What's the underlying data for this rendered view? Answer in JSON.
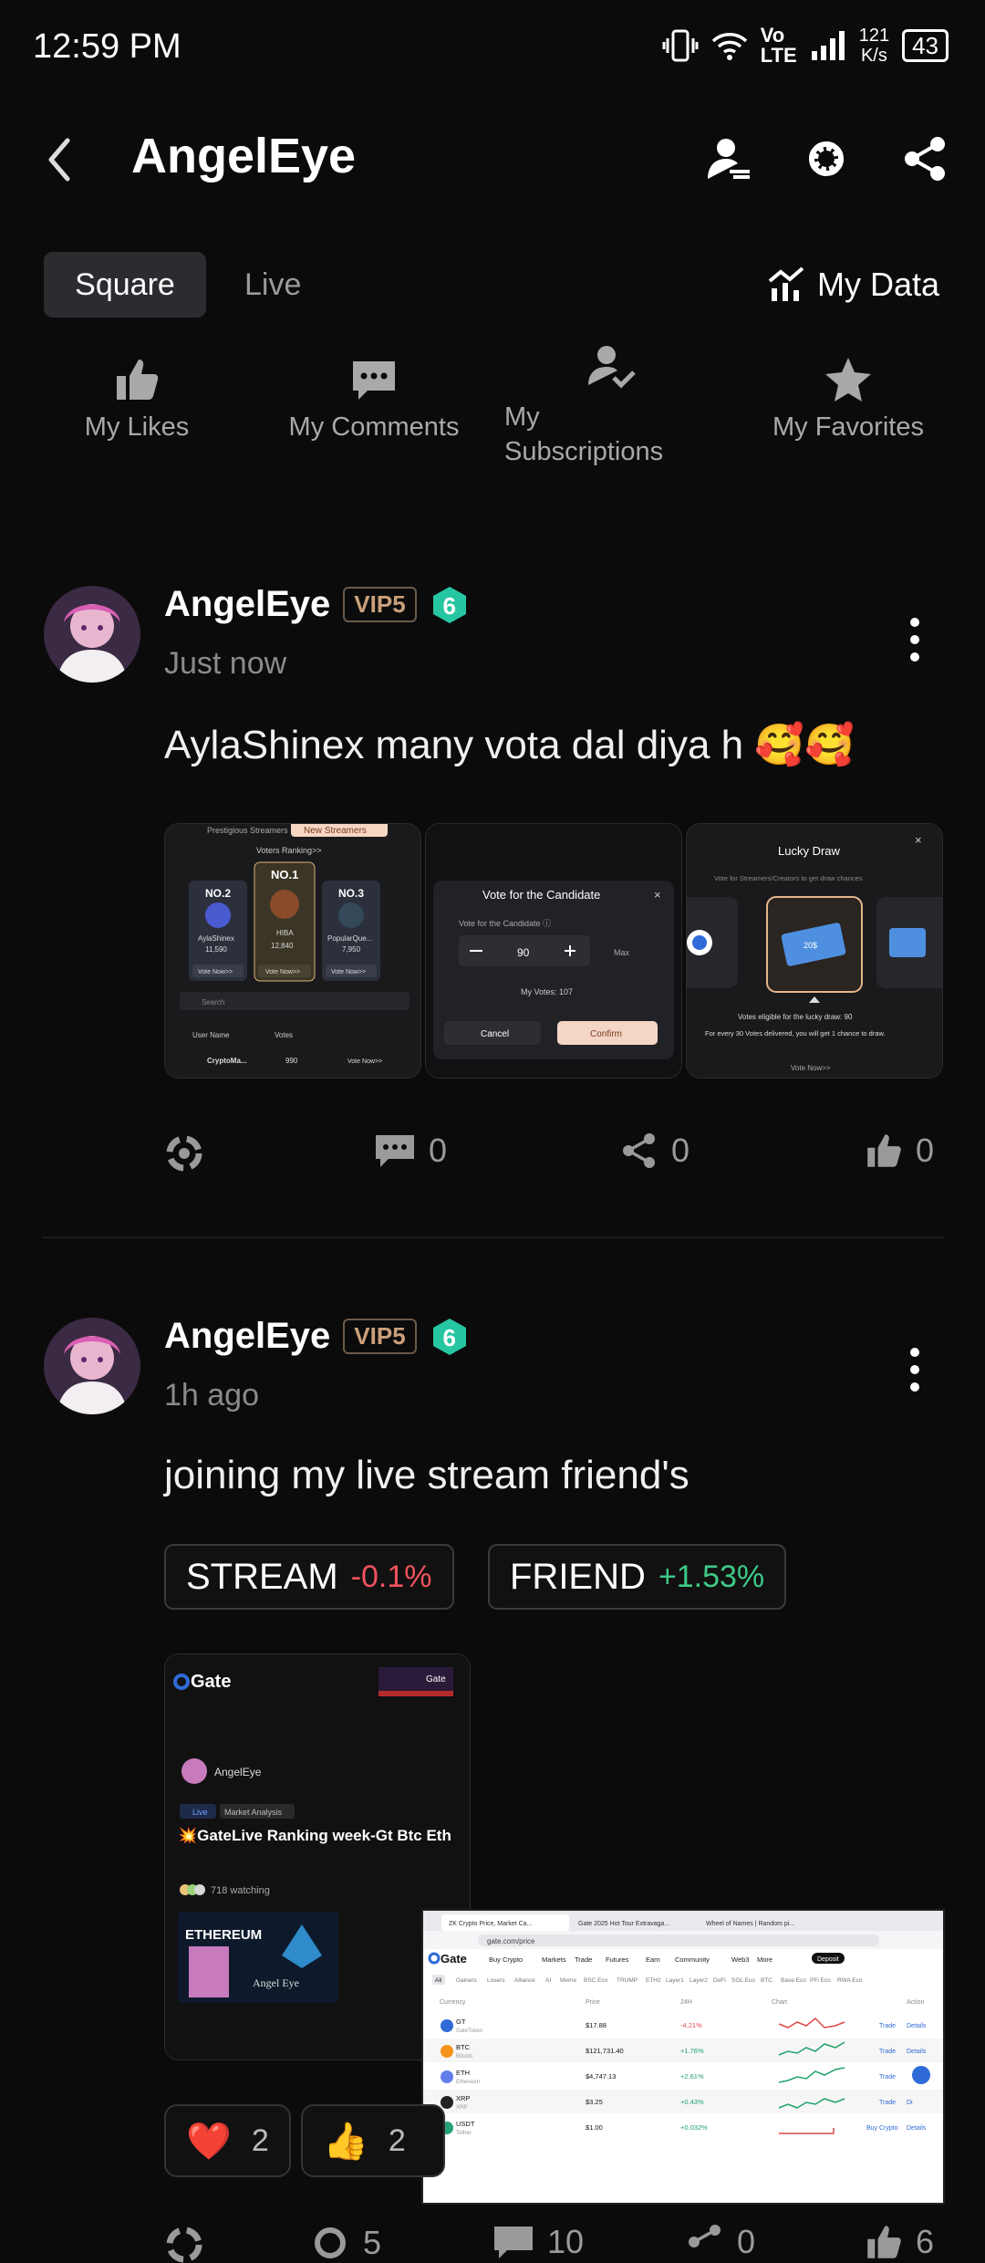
{
  "status_bar": {
    "time": "12:59 PM",
    "net_rate_top": "121",
    "net_rate_bottom": "K/s",
    "battery": "43",
    "volte": "Vo LTE"
  },
  "header": {
    "title": "AngelEye",
    "icons": [
      "back-arrow-icon",
      "person-icon",
      "gear-icon",
      "share-icon"
    ]
  },
  "tabs": {
    "square": "Square",
    "live": "Live",
    "my_data": "My Data"
  },
  "quick_actions": [
    {
      "label": "My Likes",
      "icon": "thumb-up-icon"
    },
    {
      "label": "My Comments",
      "icon": "comment-icon"
    },
    {
      "label": "My Subscriptions",
      "icon": "subscription-icon"
    },
    {
      "label": "My Favorites",
      "icon": "star-icon"
    }
  ],
  "posts": [
    {
      "username": "AngelEye",
      "vip": "VIP5",
      "level": "6",
      "time": "Just now",
      "content": "AylaShinex many vota dal diya h 🥰🥰",
      "images": {
        "img1": {
          "tabs": [
            "Prestigious Streamers",
            "New Streamers"
          ],
          "header": "Voters Ranking>>",
          "ranks": [
            {
              "rank": "NO.2",
              "name": "AylaShinex",
              "votes": "11,590",
              "btn": "Vote Now>>"
            },
            {
              "rank": "NO.1",
              "name": "HIBA",
              "votes": "12,840",
              "btn": "Vote Now>>"
            },
            {
              "rank": "NO.3",
              "name": "PopularQue...",
              "votes": "7,950",
              "btn": "Vote Now>>"
            }
          ],
          "search": "Search",
          "col_user": "User Name",
          "col_votes": "Votes",
          "row_name": "CryptoMa...",
          "row_votes": "990",
          "row_btn": "Vote Now>>"
        },
        "img2": {
          "title": "Vote for the Candidate",
          "label": "Vote for the Candidate ⓘ",
          "value": "90",
          "max": "Max",
          "my_votes": "My Votes: 107",
          "cancel": "Cancel",
          "confirm": "Confirm"
        },
        "img3": {
          "title": "Lucky Draw",
          "subtitle": "Vote for Streamers/Creators to get draw chances",
          "ticket": "20$",
          "eligible": "Votes eligible for the lucky draw: 90",
          "desc": "For every 30 Votes delivered, you will get 1 chance to draw.",
          "vote": "Vote Now>>"
        }
      },
      "actions": {
        "comments": "0",
        "shares": "0",
        "likes": "0"
      }
    },
    {
      "username": "AngelEye",
      "vip": "VIP5",
      "level": "6",
      "time": "1h ago",
      "content": "joining my live stream friend's",
      "tags": [
        {
          "name": "STREAM",
          "change": "-0.1%"
        },
        {
          "name": "FRIEND",
          "change": "+1.53%"
        }
      ],
      "live_card": {
        "brand": "Gate",
        "brand2": "Gate",
        "host": "AngelEye",
        "live_badge": "Live",
        "category": "Market Analysis",
        "title": "💥GateLive Ranking week-Gt Btc Eth",
        "watching": "718 watching",
        "banner_text": "ETHEREUM",
        "banner_name": "Angel Eye"
      },
      "pip": {
        "tab1": "ZK Crypto Price, Market Ca...",
        "tab2": "Gate 2025 Hot Tour Extravaga...",
        "tab3": "Wheel of Names | Random pi...",
        "url": "gate.com/price",
        "nav": [
          "Buy Crypto",
          "Markets",
          "Trade",
          "Futures",
          "Earn",
          "Community",
          "Web3",
          "More"
        ],
        "deposit": "Deposit",
        "filters": [
          "All",
          "Gainers",
          "Losers",
          "Alliance",
          "AI",
          "Meme",
          "BSC Eco",
          "TRUMP",
          "ETH2",
          "Layer1",
          "Layer2",
          "DeFi",
          "SOL Eco",
          "BTC",
          "Base Eco",
          "PFi Eco",
          "RWA Eco"
        ],
        "cols": [
          "Currency",
          "Price",
          "24H",
          "Chart",
          "Action"
        ],
        "rows": [
          {
            "sym": "GT",
            "name": "GateToken",
            "price": "$17.88",
            "chg": "-4.21%",
            "trade": "Trade",
            "det": "Details"
          },
          {
            "sym": "BTC",
            "name": "Bitcoin",
            "price": "$121,731.40",
            "chg": "+1.76%",
            "trade": "Trade",
            "det": "Details"
          },
          {
            "sym": "ETH",
            "name": "Ethereum",
            "price": "$4,747.13",
            "chg": "+2.61%",
            "trade": "Trade",
            "det": "Details"
          },
          {
            "sym": "XRP",
            "name": "XRP",
            "price": "$3.25",
            "chg": "+0.43%",
            "trade": "Trade",
            "det": "Di"
          },
          {
            "sym": "USDT",
            "name": "Tether",
            "price": "$1.00",
            "chg": "+0.032%",
            "trade": "Buy Crypto",
            "det": "Details"
          }
        ]
      },
      "reactions": [
        {
          "emoji": "❤️",
          "count": "2"
        },
        {
          "emoji": "👍",
          "count": "2"
        }
      ],
      "actions": {
        "comments": "5",
        "shares": "10",
        "reposts": "0",
        "likes": "6"
      }
    }
  ]
}
